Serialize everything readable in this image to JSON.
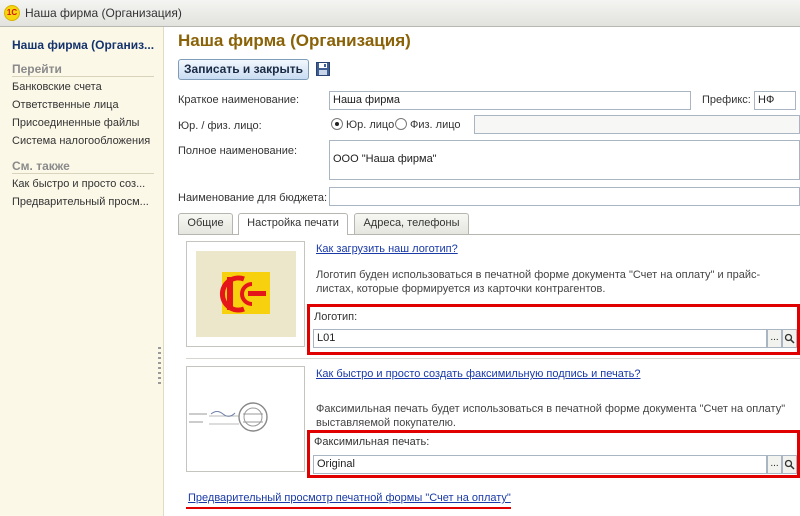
{
  "window": {
    "title": "Наша фирма (Организация)",
    "logo": "1С"
  },
  "sidebar": {
    "title": "Наша фирма (Организ...",
    "goto_header": "Перейти",
    "goto_items": [
      {
        "label": "Банковские счета"
      },
      {
        "label": "Ответственные лица"
      },
      {
        "label": "Присоединенные файлы"
      },
      {
        "label": "Система налогообложения"
      }
    ],
    "see_also_header": "См. также",
    "see_also_items": [
      {
        "label": "Как быстро и просто соз..."
      },
      {
        "label": "Предварительный просм..."
      }
    ]
  },
  "main": {
    "title": "Наша фирма (Организация)",
    "save_close_label": "Записать и закрыть",
    "short_name_label": "Краткое наименование:",
    "short_name_value": "Наша фирма",
    "prefix_label": "Префикс:",
    "prefix_value": "НФ",
    "legal_label": "Юр. / физ. лицо:",
    "legal_option": "Юр. лицо",
    "physical_option": "Физ. лицо",
    "legal_selected": "Юр. лицо",
    "full_name_label": "Полное наименование:",
    "full_name_value": "ООО \"Наша фирма\"",
    "budget_label": "Наименование для бюджета:",
    "budget_value": ""
  },
  "tabs": [
    {
      "label": "Общие"
    },
    {
      "label": "Настройка печати"
    },
    {
      "label": "Адреса, телефоны"
    }
  ],
  "active_tab": "Настройка печати",
  "print": {
    "logo_link": "Как загрузить наш логотип?",
    "logo_desc_1": "Логотип буден использоваться в печатной форме документа \"Счет на оплату\" и прайс-",
    "logo_desc_2": "листах, которые формируется из карточки контрагентов.",
    "logo_label": "Логотип:",
    "logo_value": "L01",
    "facsimile_link": "Как быстро и просто создать факсимильную подпись и печать?",
    "facsimile_desc_1": "Факсимильная печать будет использоваться в печатной форме документа \"Счет на оплату\"",
    "facsimile_desc_2": "выставляемой покупателю.",
    "facsimile_label": "Факсимильная печать:",
    "facsimile_value": "Original",
    "preview_link": "Предварительный просмотр печатной формы \"Счет на оплату\"",
    "select_btn": "...",
    "search_icon": "magnifier-icon"
  },
  "colors": {
    "accent_title": "#8a6208",
    "sidebar_bg": "#fbf8e8",
    "highlight": "#e00000",
    "link": "#1a3aa8",
    "logo_red": "#e4161a",
    "logo_yellow": "#f7d00e"
  }
}
